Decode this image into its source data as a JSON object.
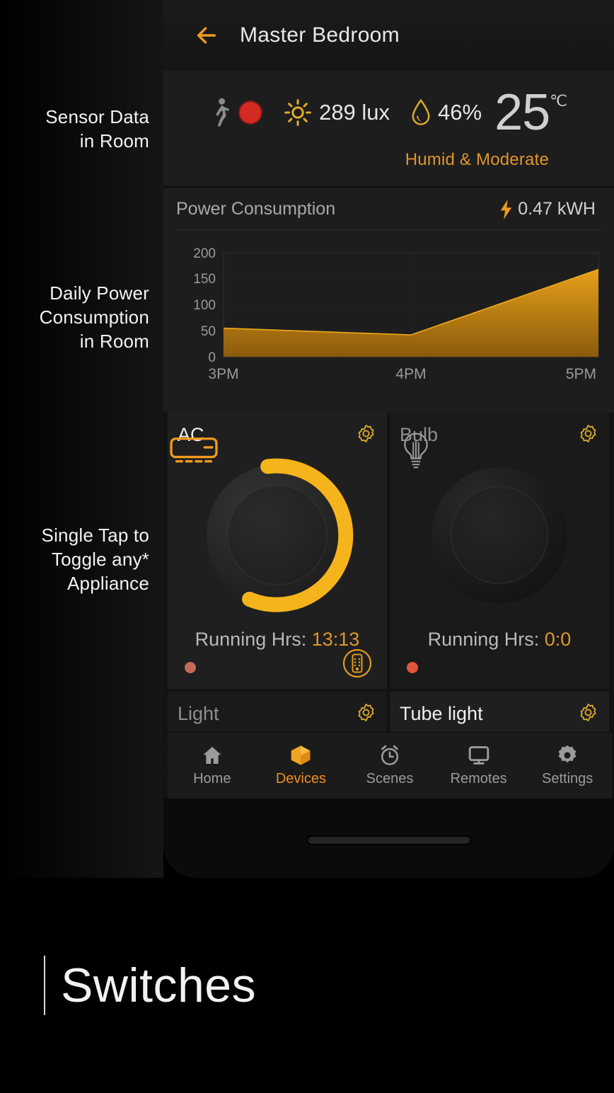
{
  "annotations": {
    "sensor": "Sensor Data\nin Room",
    "sensor_l1": "Sensor Data",
    "sensor_l2": "in Room",
    "power_l1": "Daily Power",
    "power_l2": "Consumption",
    "power_l3": "in Room",
    "toggle_l1": "Single Tap to",
    "toggle_l2": "Toggle any*",
    "toggle_l3": "Appliance"
  },
  "appbar": {
    "back_icon": "back-arrow-icon",
    "title": "Master Bedroom"
  },
  "sensor": {
    "motion_icon": "walking-person-icon",
    "motion_state_icon": "motion-indicator-dot",
    "lux_icon": "sun-icon",
    "lux_value": "289 lux",
    "humidity_icon": "water-drop-icon",
    "humidity_value": "46%",
    "temperature_value": "25",
    "temperature_unit": "℃",
    "status_text": "Humid & Moderate"
  },
  "power": {
    "title": "Power Consumption",
    "bolt_icon": "lightning-bolt-icon",
    "kwh_value": "0.47 kWH"
  },
  "chart_data": {
    "type": "area",
    "title": "Power Consumption",
    "xlabel": "",
    "ylabel": "",
    "x": [
      "3PM",
      "4PM",
      "5PM"
    ],
    "categories": [
      "3PM",
      "4PM",
      "5PM"
    ],
    "values": [
      55,
      42,
      168
    ],
    "yticks": [
      0,
      50,
      100,
      150,
      200
    ],
    "ytick_labels": [
      "0",
      "50",
      "100",
      "150",
      "200"
    ],
    "ylim": [
      0,
      200
    ],
    "grid": true,
    "legend": "none",
    "series_color": "#d98b10",
    "fill_gradient": [
      "#e09a16",
      "#8a5e0d"
    ]
  },
  "devices": [
    {
      "name": "AC",
      "on": true,
      "icon": "air-conditioner-icon",
      "gear_icon": "gear-icon",
      "hours_label": "Running Hrs:",
      "hours_value": "13:13",
      "status_dot": "status-dot",
      "remote_icon": "remote-control-icon"
    },
    {
      "name": "Bulb",
      "on": false,
      "icon": "light-bulb-icon",
      "gear_icon": "gear-icon",
      "hours_label": "Running Hrs:",
      "hours_value": "0:0",
      "status_dot": "status-dot",
      "remote_icon": null
    },
    {
      "name": "Light",
      "on": false,
      "icon": "light-bulb-icon",
      "gear_icon": "gear-icon"
    },
    {
      "name": "Tube light",
      "on": true,
      "icon": "tube-light-icon",
      "gear_icon": "gear-icon"
    }
  ],
  "nav": {
    "items": [
      {
        "label": "Home",
        "icon": "home-icon",
        "active": false
      },
      {
        "label": "Devices",
        "icon": "cube-icon",
        "active": true
      },
      {
        "label": "Scenes",
        "icon": "alarm-clock-icon",
        "active": false
      },
      {
        "label": "Remotes",
        "icon": "monitor-icon",
        "active": false
      },
      {
        "label": "Settings",
        "icon": "gear-icon",
        "active": false
      }
    ]
  },
  "footer": {
    "caption": "Switches"
  },
  "colors": {
    "accent": "#ef8f1c",
    "accent_soft": "#e0952a",
    "knob_active": "#f6b41c",
    "alert_red": "#d32b22",
    "status_dot": "#e2553a",
    "chart_fill": "#d98b10",
    "screen_bg": "#121212",
    "card_bg": "#1f1f1f"
  }
}
